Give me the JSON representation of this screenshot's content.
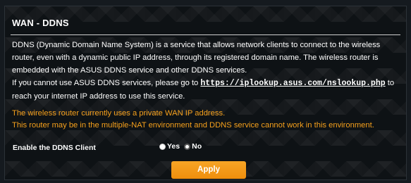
{
  "panel": {
    "title": "WAN - DDNS"
  },
  "description": {
    "paragraph1": "DDNS (Dynamic Domain Name System) is a service that allows network clients to connect to the wireless router, even with a dynamic public IP address, through its registered domain name. The wireless router is embedded with the ASUS DDNS service and other DDNS services.",
    "paragraph2_before": "If you cannot use ASUS DDNS services, please go to ",
    "link": "https://iplookup.asus.com/nslookup.php",
    "paragraph2_after": " to reach your internet IP address to use this service."
  },
  "warnings": {
    "line1": "The wireless router currently uses a private WAN IP address.",
    "line2": "This router may be in the multiple-NAT environment and DDNS service cannot work in this environment."
  },
  "ddns_client": {
    "label": "Enable the DDNS Client",
    "option_yes": "Yes",
    "option_no": "No",
    "selected": "No"
  },
  "apply_label": "Apply",
  "colors": {
    "warning": "#f5a01c",
    "button": "#f39a14",
    "background": "#0e1215"
  }
}
